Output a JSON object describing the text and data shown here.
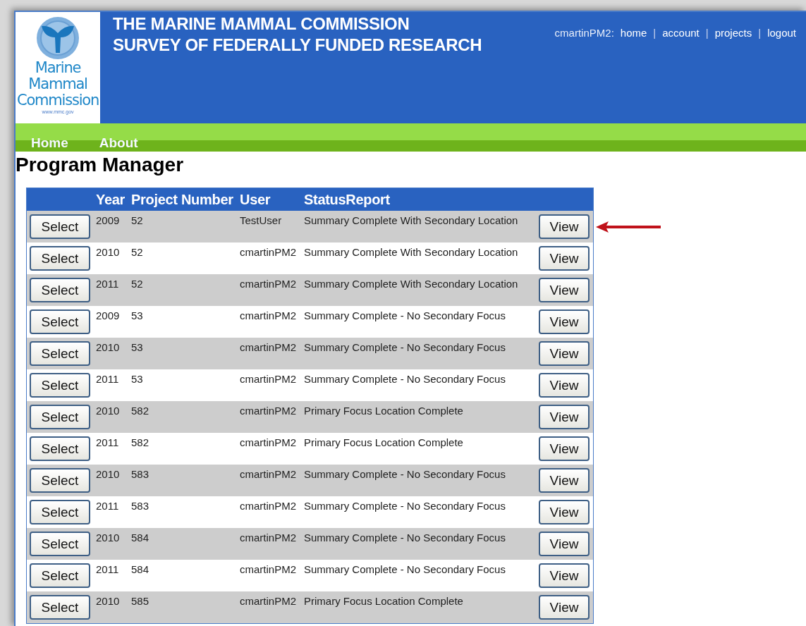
{
  "logo": {
    "lines": [
      "Marine",
      "Mammal",
      "Commission"
    ],
    "url": "www.mmc.gov"
  },
  "header": {
    "title_lines": [
      "THE MARINE MAMMAL COMMISSION",
      "SURVEY OF FEDERALLY FUNDED RESEARCH"
    ],
    "user": "cmartinPM2:",
    "links": [
      "home",
      "account",
      "projects",
      "logout"
    ],
    "separator": "|"
  },
  "nav": [
    "Home",
    "About"
  ],
  "page_title": "Program Manager",
  "callout": {
    "kind": "arrow"
  },
  "table": {
    "columns": [
      "Year",
      "Project Number",
      "User",
      "StatusReport"
    ],
    "rows": [
      {
        "year": "2009",
        "project": "52",
        "user": "TestUser",
        "status": "Summary Complete With Secondary Location",
        "select": "Select",
        "view": "View"
      },
      {
        "year": "2010",
        "project": "52",
        "user": "cmartinPM2",
        "status": "Summary Complete With Secondary Location",
        "select": "Select",
        "view": "View"
      },
      {
        "year": "2011",
        "project": "52",
        "user": "cmartinPM2",
        "status": "Summary Complete With Secondary Location",
        "select": "Select",
        "view": "View"
      },
      {
        "year": "2009",
        "project": "53",
        "user": "cmartinPM2",
        "status": "Summary Complete - No Secondary Focus",
        "select": "Select",
        "view": "View"
      },
      {
        "year": "2010",
        "project": "53",
        "user": "cmartinPM2",
        "status": "Summary Complete - No Secondary Focus",
        "select": "Select",
        "view": "View"
      },
      {
        "year": "2011",
        "project": "53",
        "user": "cmartinPM2",
        "status": "Summary Complete - No Secondary Focus",
        "select": "Select",
        "view": "View"
      },
      {
        "year": "2010",
        "project": "582",
        "user": "cmartinPM2",
        "status": "Primary Focus Location Complete",
        "select": "Select",
        "view": "View"
      },
      {
        "year": "2011",
        "project": "582",
        "user": "cmartinPM2",
        "status": "Primary Focus Location Complete",
        "select": "Select",
        "view": "View"
      },
      {
        "year": "2010",
        "project": "583",
        "user": "cmartinPM2",
        "status": "Summary Complete - No Secondary Focus",
        "select": "Select",
        "view": "View"
      },
      {
        "year": "2011",
        "project": "583",
        "user": "cmartinPM2",
        "status": "Summary Complete - No Secondary Focus",
        "select": "Select",
        "view": "View"
      },
      {
        "year": "2010",
        "project": "584",
        "user": "cmartinPM2",
        "status": "Summary Complete - No Secondary Focus",
        "select": "Select",
        "view": "View"
      },
      {
        "year": "2011",
        "project": "584",
        "user": "cmartinPM2",
        "status": "Summary Complete - No Secondary Focus",
        "select": "Select",
        "view": "View"
      },
      {
        "year": "2010",
        "project": "585",
        "user": "cmartinPM2",
        "status": "Primary Focus Location Complete",
        "select": "Select",
        "view": "View"
      }
    ]
  }
}
